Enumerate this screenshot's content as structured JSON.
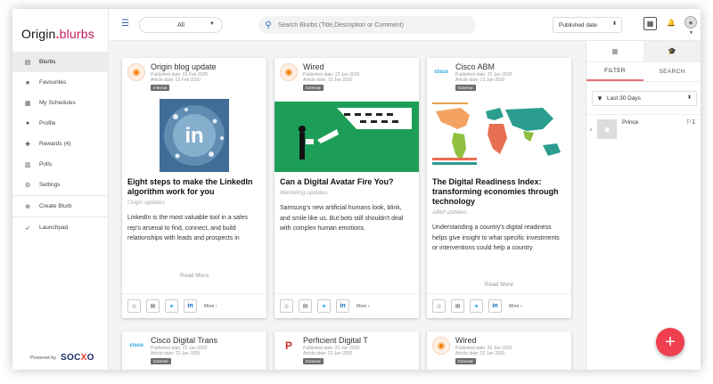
{
  "brand": {
    "name_left": "Origin",
    "name_right": "blurbs"
  },
  "sidebar": {
    "items": [
      {
        "label": "Blurbs",
        "icon": "document-icon"
      },
      {
        "label": "Favourites",
        "icon": "star-icon"
      },
      {
        "label": "My Schedules",
        "icon": "calendar-icon"
      },
      {
        "label": "Profile",
        "icon": "person-icon"
      },
      {
        "label": "Rewards (4)",
        "icon": "gift-icon"
      },
      {
        "label": "Polls",
        "icon": "bar-chart-icon"
      },
      {
        "label": "Settings",
        "icon": "gear-icon"
      },
      {
        "label": "Create Blurb",
        "icon": "plus-circle-icon"
      },
      {
        "label": "Launchpad",
        "icon": "rocket-icon"
      }
    ],
    "powered_by": "Powered by",
    "powered_brand_a": "SOC",
    "powered_brand_b": "X",
    "powered_brand_c": "O"
  },
  "topbar": {
    "filter_value": "All",
    "search_placeholder": "Search Blurbs (Title,Description or Comment)",
    "sort_value": "Published date"
  },
  "cards": [
    {
      "source": "Origin blog update",
      "published": "Published date: 03 Feb 2020",
      "article": "Article date: 03 Feb 2020",
      "badge": "Internal",
      "title": "Eight steps to make the LinkedIn algorithm work for you",
      "subtitle": "Origin updates",
      "desc": "LinkedIn is the most valuable tool in a sales rep's arsenal to find, connect, and build relationships with leads and prospects in",
      "read_more": "Read More",
      "more": "More ›"
    },
    {
      "source": "Wired",
      "published": "Published date: 22 Jan 2020",
      "article": "Article date: 15 Jan 2020",
      "badge": "External",
      "title": "Can a Digital Avatar Fire You?",
      "subtitle": "Marketing updates",
      "desc": "Samsung's new artificial humans look, blink, and smile like us. But bots still shouldn't deal with complex human emotions.",
      "read_more": "Read More",
      "more": "More ›"
    },
    {
      "source": "Cisco ABM",
      "published": "Published date: 22 Jan 2020",
      "article": "Article date: 22 Jan 2020",
      "badge": "External",
      "title": "The Digital Readiness Index: transforming economies through technology",
      "subtitle": "ABM updates",
      "desc": "Understanding a country's digital readiness helps give insight to what specific investments or interventions could help a country",
      "read_more": "Read More",
      "more": "More ›"
    },
    {
      "source": "Cisco Digital Trans",
      "published": "Published date: 22 Jan 2020",
      "article": "Article date: 22 Jan 2020",
      "badge": "External"
    },
    {
      "source": "Perficient Digital T",
      "published": "Published date: 22 Jan 2020",
      "article": "Article date: 22 Jan 2020",
      "badge": "External"
    },
    {
      "source": "Wired",
      "published": "Published date: 22 Jan 2020",
      "article": "Article date: 22 Jan 2020",
      "badge": "External"
    }
  ],
  "thumb_text": {
    "linkedin": "in"
  },
  "right_panel": {
    "tab_filter": "FILTER",
    "tab_search": "SEARCH",
    "range": "Last 30 Days",
    "people": [
      {
        "rank": "6",
        "name": "Prince",
        "count": "1"
      }
    ]
  },
  "colors": {
    "accent": "#ef3f4f",
    "primary": "#2b5ea8",
    "linkedin": "#0a66c2",
    "twitter": "#1da1f2"
  }
}
